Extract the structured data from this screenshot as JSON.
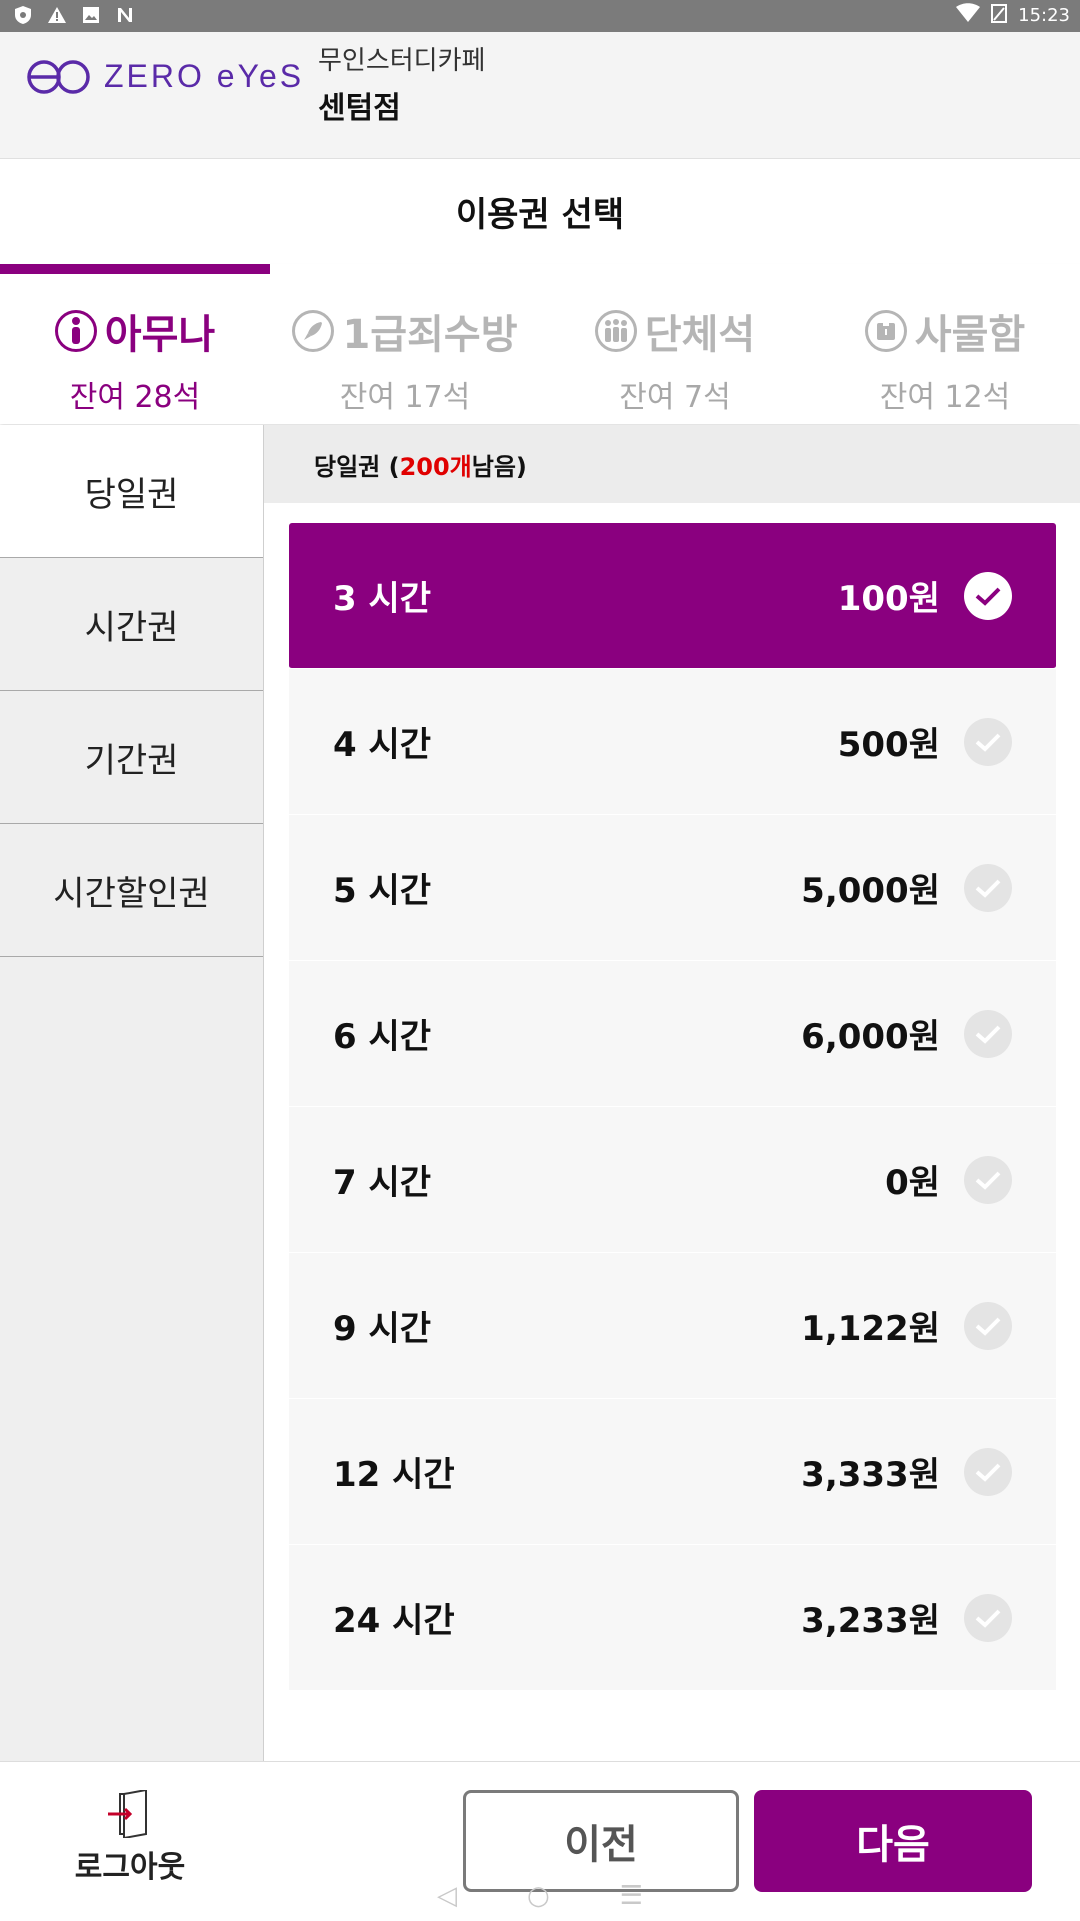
{
  "status_bar": {
    "time": "15:23",
    "left_icons": [
      "shield-icon",
      "warning-icon",
      "image-icon",
      "n-icon"
    ],
    "right_icons": [
      "wifi-icon",
      "battery-icon"
    ]
  },
  "header": {
    "logo_text": "ZERO eYeS",
    "store_subtitle": "무인스터디카페",
    "store_name": "센텀점"
  },
  "page_title": "이용권 선택",
  "seat_tabs": [
    {
      "name": "아무나",
      "remain": "잔여 28석",
      "icon": "person-icon",
      "active": true
    },
    {
      "name": "1급죄수방",
      "remain": "잔여 17석",
      "icon": "rocket-icon",
      "active": false
    },
    {
      "name": "단체석",
      "remain": "잔여 7석",
      "icon": "group-icon",
      "active": false
    },
    {
      "name": "사물함",
      "remain": "잔여 12석",
      "icon": "locker-icon",
      "active": false
    }
  ],
  "categories": [
    {
      "label": "당일권",
      "active": true
    },
    {
      "label": "시간권",
      "active": false
    },
    {
      "label": "기간권",
      "active": false
    },
    {
      "label": "시간할인권",
      "active": false
    }
  ],
  "list_header": {
    "prefix": "당일권 (",
    "count": "200개",
    "suffix": " 남음)"
  },
  "tickets": [
    {
      "label": "3 시간",
      "price": "100원",
      "selected": true
    },
    {
      "label": "4 시간",
      "price": "500원",
      "selected": false
    },
    {
      "label": "5 시간",
      "price": "5,000원",
      "selected": false
    },
    {
      "label": "6 시간",
      "price": "6,000원",
      "selected": false
    },
    {
      "label": "7 시간",
      "price": "0원",
      "selected": false
    },
    {
      "label": "9 시간",
      "price": "1,122원",
      "selected": false
    },
    {
      "label": "12 시간",
      "price": "3,333원",
      "selected": false
    },
    {
      "label": "24 시간",
      "price": "3,233원",
      "selected": false
    }
  ],
  "bottom": {
    "logout_label": "로그아웃",
    "prev_label": "이전",
    "next_label": "다음"
  },
  "colors": {
    "accent": "#8a007f",
    "count_red": "#e00000",
    "status_bar": "#7b7b7b"
  }
}
